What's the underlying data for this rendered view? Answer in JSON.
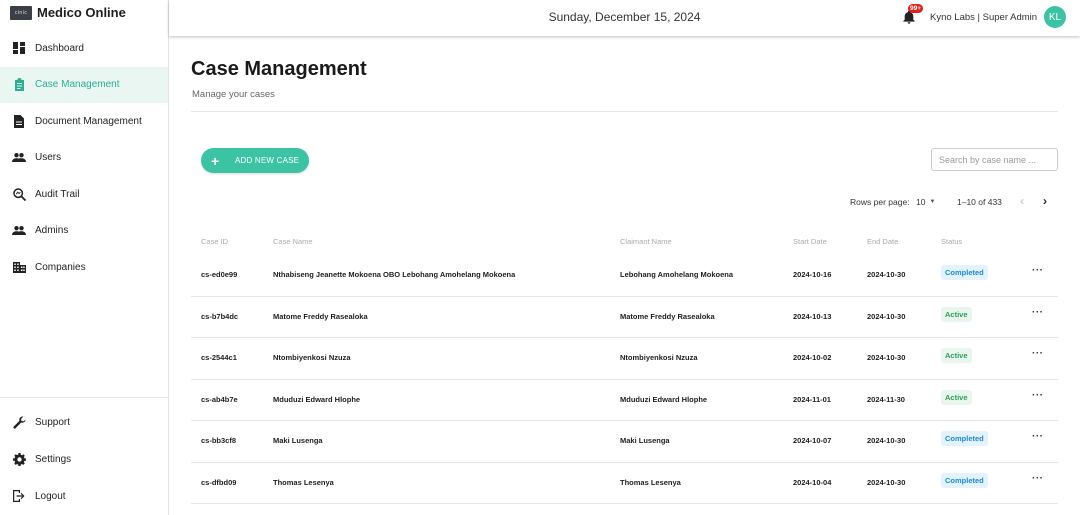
{
  "app": {
    "logo_text": "cinic",
    "name": "Medico Online"
  },
  "sidebar": {
    "items": [
      {
        "label": "Dashboard",
        "icon": "dashboard-icon",
        "active": false
      },
      {
        "label": "Case Management",
        "icon": "clipboard-icon",
        "active": true
      },
      {
        "label": "Document Management",
        "icon": "document-icon",
        "active": false
      },
      {
        "label": "Users",
        "icon": "users-icon",
        "active": false
      },
      {
        "label": "Audit Trail",
        "icon": "audit-search-icon",
        "active": false
      },
      {
        "label": "Admins",
        "icon": "admins-icon",
        "active": false
      },
      {
        "label": "Companies",
        "icon": "companies-icon",
        "active": false
      }
    ],
    "bottom_items": [
      {
        "label": "Support",
        "icon": "wrench-icon"
      },
      {
        "label": "Settings",
        "icon": "gear-icon"
      },
      {
        "label": "Logout",
        "icon": "logout-icon"
      }
    ],
    "accent_color": "#2aae94"
  },
  "header": {
    "date": "Sunday, December 15, 2024",
    "notification_count": "99+",
    "user": "Kyno Labs | Super Admin",
    "avatar_initials": "KL"
  },
  "main": {
    "title": "Case Management",
    "subtitle": "Manage your cases",
    "add_button": "ADD NEW CASE",
    "search_placeholder": "Search by case name ...",
    "pagination": {
      "rows_per_page_label": "Rows per page:",
      "rows_per_page": "10",
      "range": "1–10 of 433"
    },
    "table": {
      "columns": [
        "Case ID",
        "Case Name",
        "Claimant Name",
        "Start Date",
        "End Date",
        "Status"
      ],
      "rows": [
        {
          "id": "cs-ed0e99",
          "case_name": "Nthabiseng Jeanette Mokoena OBO Lebohang Amohelang Mokoena",
          "claimant": "Lebohang Amohelang Mokoena",
          "start": "2024-10-16",
          "end": "2024-10-30",
          "status": "Completed"
        },
        {
          "id": "cs-b7b4dc",
          "case_name": "Matome Freddy Rasealoka",
          "claimant": "Matome Freddy Rasealoka",
          "start": "2024-10-13",
          "end": "2024-10-30",
          "status": "Active"
        },
        {
          "id": "cs-2544c1",
          "case_name": "Ntombiyenkosi Nzuza",
          "claimant": "Ntombiyenkosi Nzuza",
          "start": "2024-10-02",
          "end": "2024-10-30",
          "status": "Active"
        },
        {
          "id": "cs-ab4b7e",
          "case_name": "Mduduzi Edward Hlophe",
          "claimant": "Mduduzi Edward Hlophe",
          "start": "2024-11-01",
          "end": "2024-11-30",
          "status": "Active"
        },
        {
          "id": "cs-bb3cf8",
          "case_name": "Maki Lusenga",
          "claimant": "Maki Lusenga",
          "start": "2024-10-07",
          "end": "2024-10-30",
          "status": "Completed"
        },
        {
          "id": "cs-dfbd09",
          "case_name": "Thomas Lesenya",
          "claimant": "Thomas Lesenya",
          "start": "2024-10-04",
          "end": "2024-10-30",
          "status": "Completed"
        }
      ],
      "row_action_icon": "more-horizontal-icon"
    },
    "status_colors": {
      "Completed": "#1e88d6",
      "Active": "#2e9e5b"
    }
  }
}
